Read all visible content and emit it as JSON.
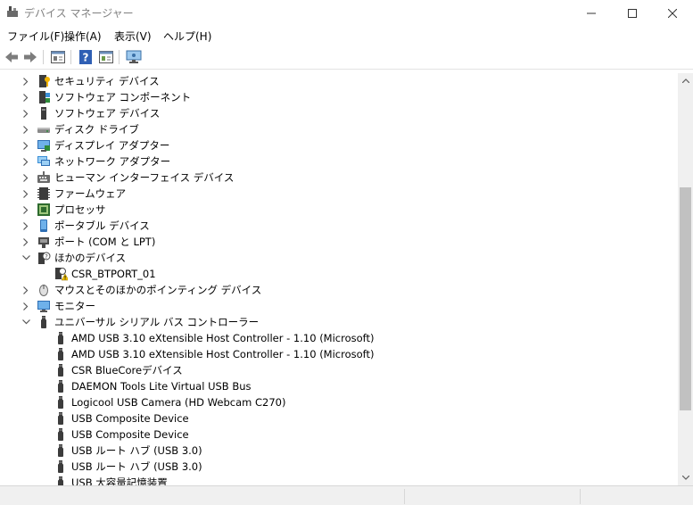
{
  "window": {
    "title": "デバイス マネージャー",
    "icon": "device-manager-icon"
  },
  "menu": {
    "file": "ファイル(F)",
    "action": "操作(A)",
    "view": "表示(V)",
    "help": "ヘルプ(H)"
  },
  "toolbar": {
    "buttons": [
      "back-arrow-icon",
      "forward-arrow-icon",
      "properties-icon",
      "help-icon",
      "view-icon",
      "scan-hardware-icon"
    ]
  },
  "tree": {
    "items": [
      {
        "label": "セキュリティ デバイス",
        "expander": "collapsed",
        "icon": "security-device-icon",
        "depth": 0
      },
      {
        "label": "ソフトウェア コンポーネント",
        "expander": "collapsed",
        "icon": "software-component-icon",
        "depth": 0
      },
      {
        "label": "ソフトウェア デバイス",
        "expander": "collapsed",
        "icon": "software-device-icon",
        "depth": 0
      },
      {
        "label": "ディスク ドライブ",
        "expander": "collapsed",
        "icon": "disk-drive-icon",
        "depth": 0
      },
      {
        "label": "ディスプレイ アダプター",
        "expander": "collapsed",
        "icon": "display-adapter-icon",
        "depth": 0
      },
      {
        "label": "ネットワーク アダプター",
        "expander": "collapsed",
        "icon": "network-adapter-icon",
        "depth": 0
      },
      {
        "label": "ヒューマン インターフェイス デバイス",
        "expander": "collapsed",
        "icon": "hid-icon",
        "depth": 0
      },
      {
        "label": "ファームウェア",
        "expander": "collapsed",
        "icon": "firmware-icon",
        "depth": 0
      },
      {
        "label": "プロセッサ",
        "expander": "collapsed",
        "icon": "processor-icon",
        "depth": 0
      },
      {
        "label": "ポータブル デバイス",
        "expander": "collapsed",
        "icon": "portable-device-icon",
        "depth": 0
      },
      {
        "label": "ポート (COM と LPT)",
        "expander": "collapsed",
        "icon": "port-icon",
        "depth": 0
      },
      {
        "label": "ほかのデバイス",
        "expander": "expanded",
        "icon": "other-device-icon",
        "depth": 0
      },
      {
        "label": "CSR_BTPORT_01",
        "expander": "none",
        "icon": "warning-device-icon",
        "depth": 1
      },
      {
        "label": "マウスとそのほかのポインティング デバイス",
        "expander": "collapsed",
        "icon": "mouse-icon",
        "depth": 0
      },
      {
        "label": "モニター",
        "expander": "collapsed",
        "icon": "monitor-icon",
        "depth": 0
      },
      {
        "label": "ユニバーサル シリアル バス コントローラー",
        "expander": "expanded",
        "icon": "usb-controller-icon",
        "depth": 0
      },
      {
        "label": "AMD USB 3.10 eXtensible Host Controller - 1.10 (Microsoft)",
        "expander": "none",
        "icon": "usb-plug-icon",
        "depth": 1
      },
      {
        "label": "AMD USB 3.10 eXtensible Host Controller - 1.10 (Microsoft)",
        "expander": "none",
        "icon": "usb-plug-icon",
        "depth": 1
      },
      {
        "label": "CSR BlueCoreデバイス",
        "expander": "none",
        "icon": "usb-plug-icon",
        "depth": 1
      },
      {
        "label": "DAEMON Tools Lite Virtual USB Bus",
        "expander": "none",
        "icon": "usb-plug-icon",
        "depth": 1
      },
      {
        "label": "Logicool USB Camera (HD Webcam C270)",
        "expander": "none",
        "icon": "usb-plug-icon",
        "depth": 1
      },
      {
        "label": "USB Composite Device",
        "expander": "none",
        "icon": "usb-plug-icon",
        "depth": 1
      },
      {
        "label": "USB Composite Device",
        "expander": "none",
        "icon": "usb-plug-icon",
        "depth": 1
      },
      {
        "label": "USB ルート ハブ (USB 3.0)",
        "expander": "none",
        "icon": "usb-plug-icon",
        "depth": 1
      },
      {
        "label": "USB ルート ハブ (USB 3.0)",
        "expander": "none",
        "icon": "usb-plug-icon",
        "depth": 1
      },
      {
        "label": "USB 大容量記憶装置",
        "expander": "none",
        "icon": "usb-plug-icon",
        "depth": 1
      }
    ]
  },
  "colors": {
    "accent_green": "#2e8b3a",
    "monitor_blue": "#3a8fd6",
    "warning_yellow": "#f2c200",
    "icon_dark": "#404040"
  }
}
